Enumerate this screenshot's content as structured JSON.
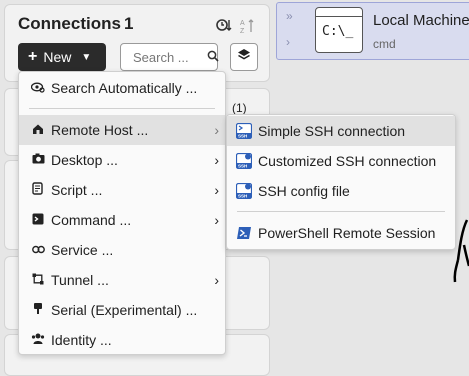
{
  "sidebar": {
    "title": "Connections",
    "count": "1",
    "partial_count": "(1)",
    "new_button": {
      "label": "New"
    },
    "search": {
      "placeholder": "Search ..."
    }
  },
  "new_menu": {
    "items": [
      {
        "label": "Search Automatically ...",
        "icon": "search-eye-icon",
        "has_submenu": false
      },
      {
        "label": "Remote Host ...",
        "icon": "home-icon",
        "has_submenu": true,
        "active": true
      },
      {
        "label": "Desktop ...",
        "icon": "camera-icon",
        "has_submenu": true
      },
      {
        "label": "Script ...",
        "icon": "script-icon",
        "has_submenu": true
      },
      {
        "label": "Command ...",
        "icon": "command-prompt-icon",
        "has_submenu": true
      },
      {
        "label": "Service ...",
        "icon": "link-icon",
        "has_submenu": false
      },
      {
        "label": "Tunnel ...",
        "icon": "tunnel-icon",
        "has_submenu": true
      },
      {
        "label": "Serial (Experimental) ...",
        "icon": "serial-plug-icon",
        "has_submenu": false
      },
      {
        "label": "Identity ...",
        "icon": "identity-icon",
        "has_submenu": false
      }
    ]
  },
  "remote_host_submenu": {
    "items": [
      {
        "label": "Simple SSH connection",
        "icon": "ssh-icon",
        "active": true
      },
      {
        "label": "Customized SSH connection",
        "icon": "ssh-gear-icon"
      },
      {
        "label": "SSH config file",
        "icon": "ssh-file-icon"
      },
      {
        "label": "PowerShell Remote Session",
        "icon": "powershell-icon"
      }
    ]
  },
  "connection_tile": {
    "name": "Local Machine",
    "subtitle": "cmd",
    "icon_text": "C:\\_"
  },
  "colors": {
    "new_button_bg": "#2b2b2b",
    "tile_bg": "#d9dcef",
    "tile_border": "#9ea5d8",
    "menu_highlight": "#e1e1e1",
    "ssh_icon_blue": "#2d5fb8"
  }
}
